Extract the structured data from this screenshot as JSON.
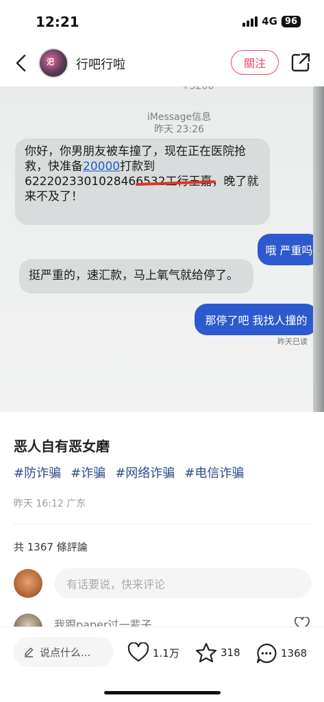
{
  "status": {
    "time": "12:21",
    "network": "4G",
    "battery": "96"
  },
  "nav": {
    "author": "行吧行啦",
    "follow_label": "關注",
    "avatar_text": "汜"
  },
  "photo": {
    "top_number": "+5200",
    "imessage_label": "iMessage信息",
    "imessage_time": "昨天 23:26",
    "msg1_part1": "你好，你男朋友被车撞了，现在正在医院抢救，快准备",
    "msg1_amount": "20000",
    "msg1_part2": "打款到",
    "msg1_account": "622202330102846",
    "msg1_struck": "6532工行王嘉",
    "msg1_part3": "，晚了就来不及了！",
    "reply1": "哦 严重吗",
    "msg2": "挺严重的，速汇款，马上氧气就给停了。",
    "reply2": "那停了吧 我找人撞的",
    "read_mark": "昨天已读"
  },
  "post": {
    "title": "恶人自有恶女磨",
    "tags": [
      "#防诈骗",
      "#诈骗",
      "#网络诈骗",
      "#电信诈骗"
    ],
    "meta": "昨天 16:12 广东"
  },
  "comments": {
    "count_text": "共 1367 條評論",
    "input_placeholder": "有话要说，快来评论",
    "first_comment": "我跟paper过一辈子"
  },
  "bottom": {
    "say_label": "说点什么...",
    "likes": "1.1万",
    "stars": "318",
    "comments": "1368"
  },
  "colors": {
    "accent": "#e8465a",
    "tag": "#2d4a8a",
    "imessage_blue": "#2d59cf"
  }
}
